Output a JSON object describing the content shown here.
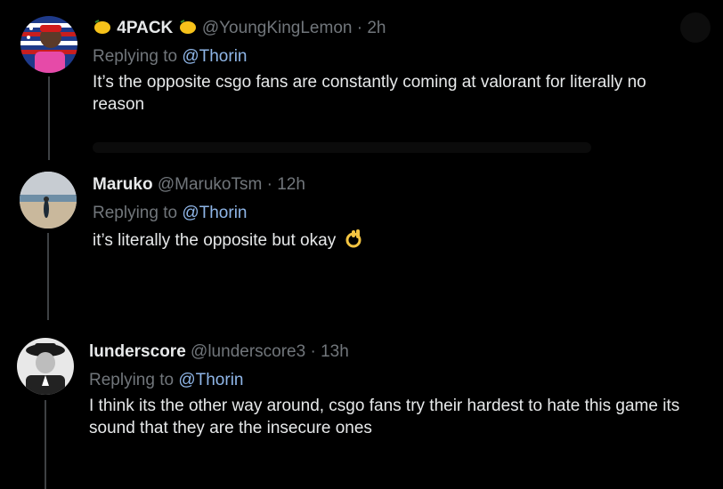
{
  "replies": [
    {
      "name_prefix_icon": "lemon-emoji",
      "name": "4PACK",
      "name_suffix_icon": "lemon-emoji",
      "handle": "@YoungKingLemon",
      "dot": "·",
      "time": "2h",
      "replying_to_label": "Replying to",
      "replying_to_user": "@Thorin",
      "text": "It’s the opposite csgo fans are constantly coming at valorant for literally no reason",
      "avatar": "american-flag-user-avatar"
    },
    {
      "name": "Maruko",
      "handle": "@MarukoTsm",
      "dot": "·",
      "time": "12h",
      "replying_to_label": "Replying to",
      "replying_to_user": "@Thorin",
      "text": "it’s literally the opposite but okay",
      "text_suffix_icon": "ok-hand-emoji",
      "avatar": "beach-photo-avatar"
    },
    {
      "name": "lunderscore",
      "handle": "@lunderscore3",
      "dot": "·",
      "time": "13h",
      "replying_to_label": "Replying to",
      "replying_to_user": "@Thorin",
      "text": "I think its the other way around, csgo fans try their hardest to hate this game its sound that they are the insecure ones",
      "avatar": "black-and-white-portrait-avatar"
    }
  ],
  "colors": {
    "background": "#000000",
    "primary_text": "#e7e9ea",
    "secondary_text": "#71767b",
    "mention": "#8fb6e8",
    "thread_line": "#3e4144"
  }
}
